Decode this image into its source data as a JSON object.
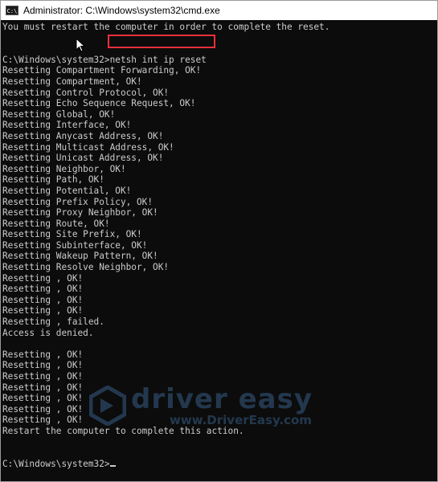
{
  "window": {
    "title": "Administrator: C:\\Windows\\system32\\cmd.exe",
    "icon": "cmd-icon",
    "icon_text": "C:\\"
  },
  "console": {
    "lines": [
      "You must restart the computer in order to complete the reset.",
      "",
      "",
      "C:\\Windows\\system32>netsh int ip reset",
      "Resetting Compartment Forwarding, OK!",
      "Resetting Compartment, OK!",
      "Resetting Control Protocol, OK!",
      "Resetting Echo Sequence Request, OK!",
      "Resetting Global, OK!",
      "Resetting Interface, OK!",
      "Resetting Anycast Address, OK!",
      "Resetting Multicast Address, OK!",
      "Resetting Unicast Address, OK!",
      "Resetting Neighbor, OK!",
      "Resetting Path, OK!",
      "Resetting Potential, OK!",
      "Resetting Prefix Policy, OK!",
      "Resetting Proxy Neighbor, OK!",
      "Resetting Route, OK!",
      "Resetting Site Prefix, OK!",
      "Resetting Subinterface, OK!",
      "Resetting Wakeup Pattern, OK!",
      "Resetting Resolve Neighbor, OK!",
      "Resetting , OK!",
      "Resetting , OK!",
      "Resetting , OK!",
      "Resetting , OK!",
      "Resetting , failed.",
      "Access is denied.",
      "",
      "Resetting , OK!",
      "Resetting , OK!",
      "Resetting , OK!",
      "Resetting , OK!",
      "Resetting , OK!",
      "Resetting , OK!",
      "Resetting , OK!",
      "Restart the computer to complete this action.",
      "",
      "",
      "C:\\Windows\\system32>"
    ]
  },
  "watermark": {
    "brand": "driver easy",
    "url": "www.DriverEasy.com",
    "icon": "driver-easy-logo-icon"
  },
  "colors": {
    "console_bg": "#0c0c0c",
    "console_text": "#cccccc",
    "highlight_border": "#e8303a",
    "watermark": "#3f6f9e"
  }
}
